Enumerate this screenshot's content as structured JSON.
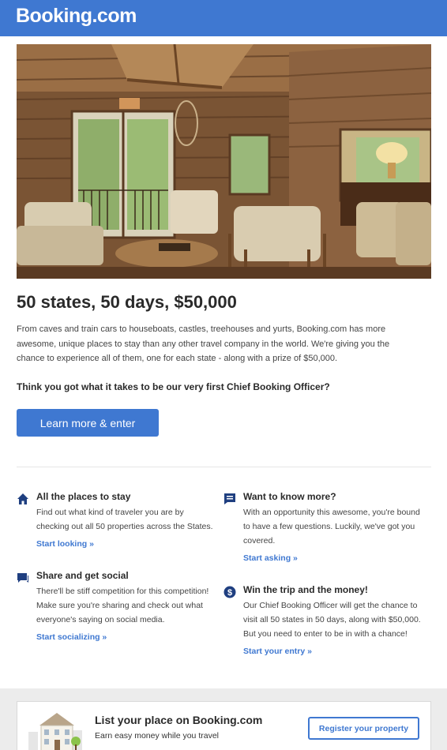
{
  "header": {
    "logo_text": "Booking.com"
  },
  "hero": {
    "image_subject": "rustic log cabin living room with wooden furniture"
  },
  "main": {
    "headline": "50 states, 50 days, $50,000",
    "intro": "From caves and train cars to houseboats, castles, treehouses and yurts, Booking.com has more awesome, unique places to stay than any other travel company in the world. We're giving you the chance to experience all of them, one for each state - along with a prize of $50,000.",
    "question": "Think you got what it takes to be our very first Chief Booking Officer?",
    "cta_label": "Learn more & enter"
  },
  "features": [
    {
      "icon": "home-icon",
      "title": "All the places to stay",
      "description": "Find out what kind of traveler you are by checking out all 50 properties across the States.",
      "link": "Start looking »"
    },
    {
      "icon": "chat-icon",
      "title": "Want to know more?",
      "description": "With an opportunity this awesome, you're bound to have a few questions. Luckily, we've got you covered.",
      "link": "Start asking »"
    },
    {
      "icon": "comment-icon",
      "title": "Share and get social",
      "description": "There'll be stiff competition for this competition! Make sure you're sharing and check out what everyone's saying on social media.",
      "link": "Start socializing »"
    },
    {
      "icon": "dollar-icon",
      "title": "Win the trip and the money!",
      "description": "Our Chief Booking Officer will get the chance to visit all 50 states in 50 days, along with $50,000. But you need to enter to be in with a chance!",
      "link": "Start your entry »"
    }
  ],
  "footer": {
    "title": "List your place on Booking.com",
    "subtitle": "Earn easy money while you travel",
    "button_label": "Register your property"
  },
  "colors": {
    "brand_blue": "#3f78d1",
    "icon_navy": "#1f3f80",
    "text_dark": "#2a2a2a"
  }
}
